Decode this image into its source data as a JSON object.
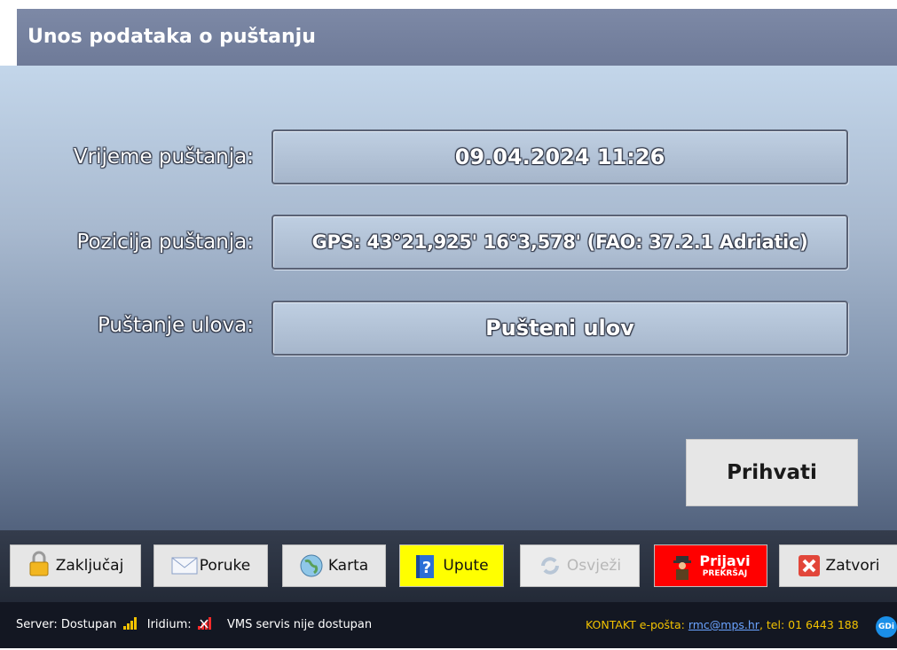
{
  "window": {
    "title": "Unos podataka o puštanju"
  },
  "form": {
    "time_label": "Vrijeme puštanja:",
    "time_value": "09.04.2024 11:26",
    "position_label": "Pozicija puštanja:",
    "position_value": "GPS: 43°21,925' 16°3,578' (FAO: 37.2.1 Adriatic)",
    "release_label": "Puštanje ulova:",
    "release_value": "Pušteni ulov"
  },
  "accept_label": "Prihvati",
  "toolbar": {
    "lock_label": "Zaključaj",
    "messages_label": "Poruke",
    "map_label": "Karta",
    "help_label": "Upute",
    "refresh_label": "Osvježi",
    "report_label": "Prijavi",
    "report_sub": "PREKRŠAJ",
    "close_label": "Zatvori"
  },
  "status": {
    "server_label": "Server: Dostupan",
    "iridium_label": "Iridium:",
    "vms_label": "VMS servis nije dostupan",
    "contact_prefix": "KONTAKT e-pošta:",
    "contact_email": "rmc@mps.hr",
    "contact_phone": ", tel: 01 6443 188",
    "badge": "GDi"
  },
  "colors": {
    "help_button": "#ffff00",
    "report_button": "#ff0000",
    "contact_text": "#f2c200",
    "server_signal": "#f2c200",
    "iridium_signal": "#ff2a2a"
  }
}
